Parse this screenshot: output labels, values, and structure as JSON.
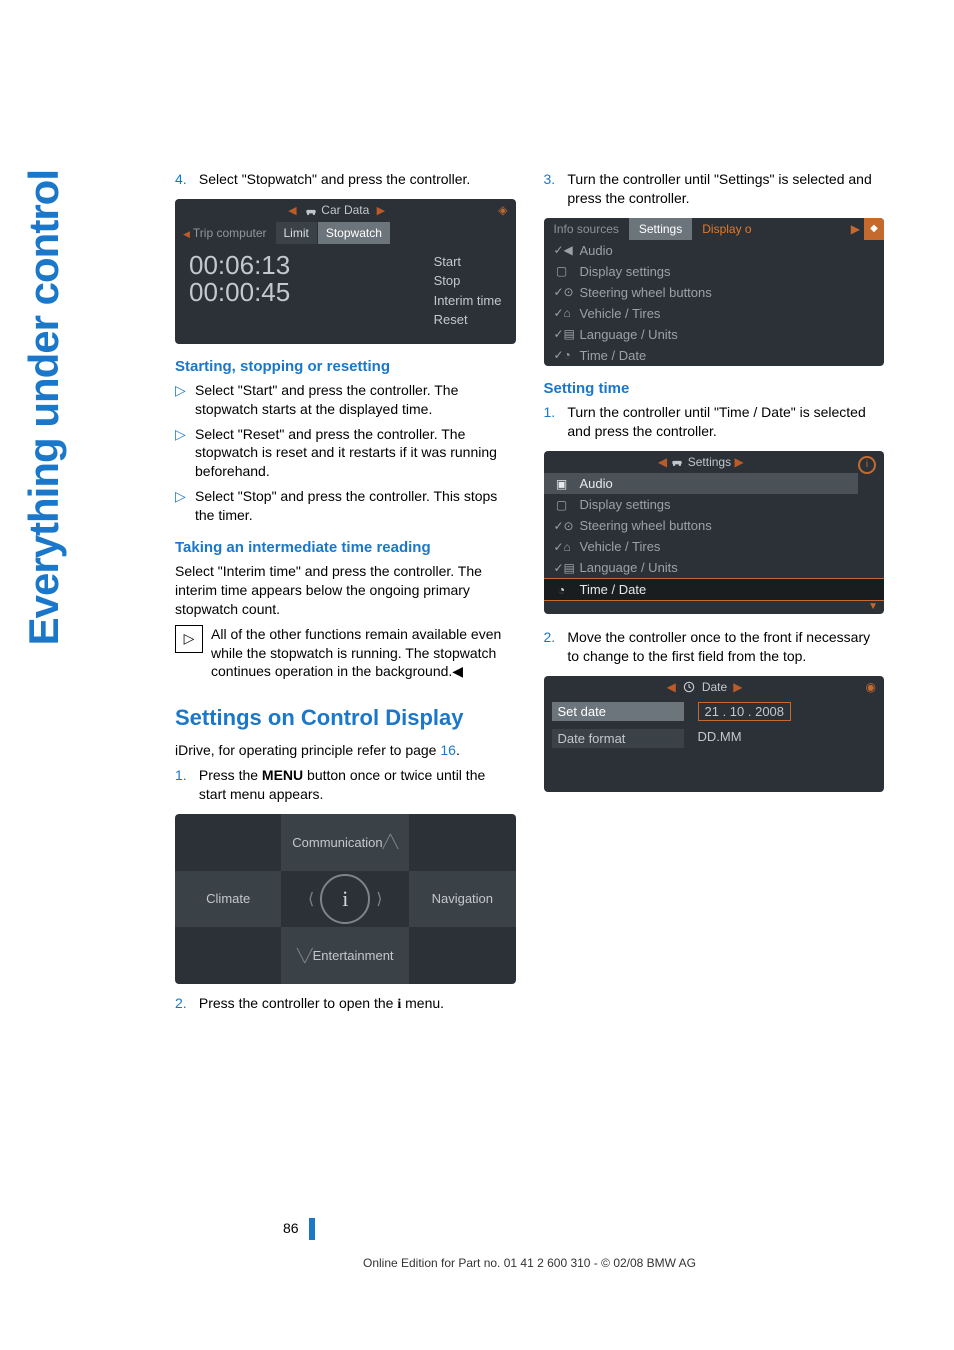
{
  "side_tab": "Everything under control",
  "left": {
    "step4": {
      "num": "4.",
      "text": "Select \"Stopwatch\" and press the controller."
    },
    "sw_screen": {
      "title_pre": "Car Data",
      "tabs": [
        "Trip computer",
        "Limit",
        "Stopwatch"
      ],
      "times": [
        "00:06:13",
        "00:00:45"
      ],
      "actions": [
        "Start",
        "Stop",
        "Interim time",
        "Reset"
      ]
    },
    "h_start": "Starting, stopping or resetting",
    "bullets": [
      "Select \"Start\" and press the controller. The stopwatch starts at the displayed time.",
      "Select \"Reset\" and press the controller. The stopwatch is reset and it restarts if it was running beforehand.",
      "Select \"Stop\" and press the controller. This stops the timer."
    ],
    "h_interim": "Taking an intermediate time reading",
    "p_interim": "Select \"Interim time\" and press the controller. The interim time appears below the ongoing primary stopwatch count.",
    "note": "All of the other functions remain available even while the stopwatch is running. The stopwatch continues operation in the background.◀",
    "h_settings": "Settings on Control Display",
    "p_idrive_a": "iDrive, for operating principle refer to page ",
    "p_idrive_link": "16",
    "p_idrive_b": ".",
    "step1": {
      "num": "1.",
      "a": "Press the ",
      "menu": "MENU",
      "b": " button once or twice until the start menu appears."
    },
    "nav": [
      "Communication",
      "Climate",
      "Navigation",
      "Entertainment"
    ],
    "step2": {
      "num": "2.",
      "a": "Press the controller to open the ",
      "i": "i",
      "b": " menu."
    }
  },
  "right": {
    "step3": {
      "num": "3.",
      "text": "Turn the controller until \"Settings\" is selected and press the controller."
    },
    "settings_tabs": [
      "Info sources",
      "Settings",
      "Display o"
    ],
    "settings_items": [
      "Audio",
      "Display settings",
      "Steering wheel buttons",
      "Vehicle / Tires",
      "Language / Units",
      "Time / Date"
    ],
    "h_set_time": "Setting time",
    "step1": {
      "num": "1.",
      "text": "Turn the controller until \"Time / Date\" is selected and press the controller."
    },
    "settings2_title": "Settings",
    "step2": {
      "num": "2.",
      "text": "Move the controller once to the front if necessary to change to the first field from the top."
    },
    "date_title": "Date",
    "date_rows": [
      {
        "label": "Set date",
        "value": "21 . 10 . 2008"
      },
      {
        "label": "Date format",
        "value": "DD.MM"
      }
    ]
  },
  "page_number": "86",
  "footer": "Online Edition for Part no. 01 41 2 600 310 - © 02/08 BMW AG",
  "chart_data": null
}
